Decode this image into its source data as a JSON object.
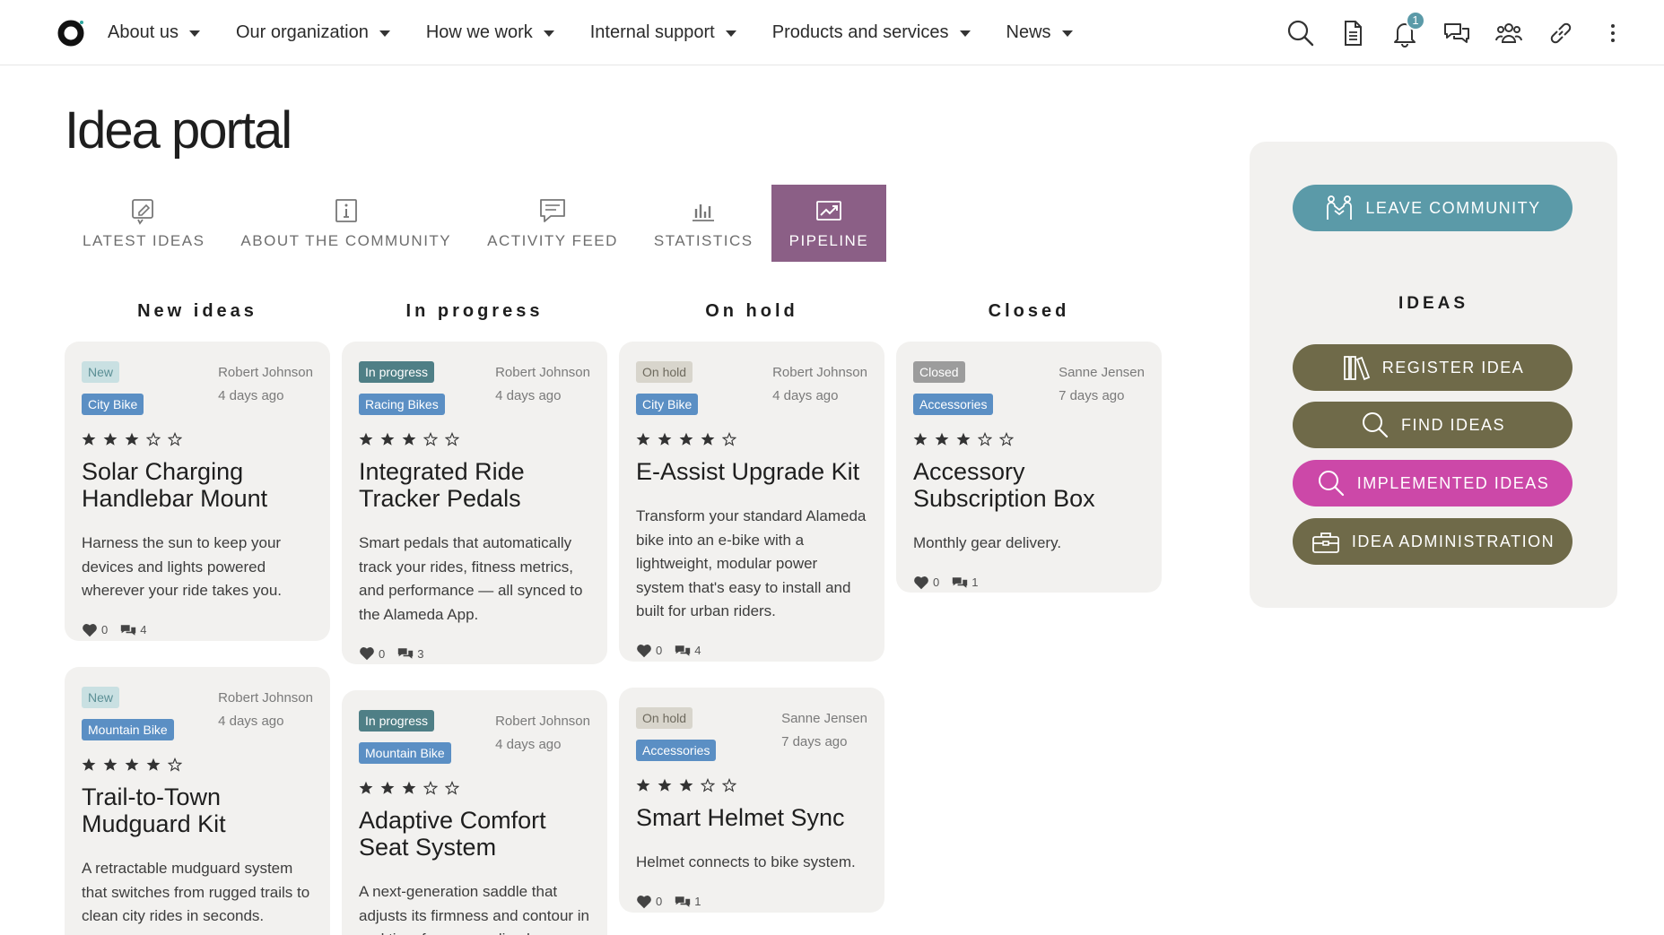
{
  "nav": {
    "items": [
      {
        "label": "About us"
      },
      {
        "label": "Our organization"
      },
      {
        "label": "How we work"
      },
      {
        "label": "Internal support"
      },
      {
        "label": "Products and services"
      },
      {
        "label": "News"
      }
    ],
    "notification_count": "1",
    "icons": [
      "search-icon",
      "document-icon",
      "bell-icon",
      "chat-icon",
      "people-icon",
      "link-icon",
      "more-icon"
    ]
  },
  "page": {
    "title": "Idea portal"
  },
  "tabs": [
    {
      "label": "LATEST IDEAS",
      "icon": "pencil-note-icon"
    },
    {
      "label": "ABOUT THE COMMUNITY",
      "icon": "info-icon"
    },
    {
      "label": "ACTIVITY FEED",
      "icon": "feed-icon"
    },
    {
      "label": "STATISTICS",
      "icon": "bar-chart-icon"
    },
    {
      "label": "PIPELINE",
      "icon": "trend-icon",
      "active": true
    }
  ],
  "columns": [
    {
      "title": "New ideas",
      "cards": [
        {
          "status": "New",
          "category": "City Bike",
          "author": "Robert Johnson",
          "time": "4 days ago",
          "rating": 3,
          "title": "Solar Charging Handlebar Mount",
          "description": "Harness the sun to keep your devices and lights powered wherever your ride takes you.",
          "likes": "0",
          "comments": "4"
        },
        {
          "status": "New",
          "category": "Mountain Bike",
          "author": "Robert Johnson",
          "time": "4 days ago",
          "rating": 4,
          "title": "Trail-to-Town Mudguard Kit",
          "description": "A retractable mudguard system that switches from rugged trails to clean city rides in seconds.",
          "likes": "",
          "comments": ""
        }
      ]
    },
    {
      "title": "In progress",
      "cards": [
        {
          "status": "In progress",
          "category": "Racing Bikes",
          "author": "Robert Johnson",
          "time": "4 days ago",
          "rating": 3,
          "title": "Integrated Ride Tracker Pedals",
          "description": "Smart pedals that automatically track your rides, fitness metrics, and performance — all synced to the Alameda App.",
          "likes": "0",
          "comments": "3"
        },
        {
          "status": "In progress",
          "category": "Mountain Bike",
          "author": "Robert Johnson",
          "time": "4 days ago",
          "rating": 3,
          "title": "Adaptive Comfort Seat System",
          "description": "A next-generation saddle that adjusts its firmness and contour in real time for personalized",
          "likes": "",
          "comments": ""
        }
      ]
    },
    {
      "title": "On hold",
      "cards": [
        {
          "status": "On hold",
          "category": "City Bike",
          "author": "Robert Johnson",
          "time": "4 days ago",
          "rating": 4,
          "title": "E-Assist Upgrade Kit",
          "description": "Transform your standard Alameda bike into an e-bike with a lightweight, modular power system that's easy to install and built for urban riders.",
          "likes": "0",
          "comments": "4"
        },
        {
          "status": "On hold",
          "category": "Accessories",
          "author": "Sanne Jensen",
          "time": "7 days ago",
          "rating": 3,
          "title": "Smart Helmet Sync",
          "description": "Helmet connects to bike system.",
          "likes": "0",
          "comments": "1"
        }
      ]
    },
    {
      "title": "Closed",
      "cards": [
        {
          "status": "Closed",
          "category": "Accessories",
          "author": "Sanne Jensen",
          "time": "7 days ago",
          "rating": 3,
          "title": "Accessory Subscription Box",
          "description": "Monthly gear delivery.",
          "likes": "0",
          "comments": "1"
        }
      ]
    }
  ],
  "sidebar": {
    "leave_label": "LEAVE COMMUNITY",
    "heading": "IDEAS",
    "buttons": [
      {
        "label": "REGISTER IDEA",
        "color": "#6f6a49",
        "icon": "books-icon"
      },
      {
        "label": "FIND IDEAS",
        "color": "#6f6a49",
        "icon": "search-icon"
      },
      {
        "label": "IMPLEMENTED IDEAS",
        "color": "#cc48a8",
        "icon": "search-icon"
      },
      {
        "label": "IDEA ADMINISTRATION",
        "color": "#6f6a49",
        "icon": "toolbox-icon"
      }
    ],
    "leave_color": "#5b9aa8"
  },
  "colors": {
    "tag_new": "#c9e0e2",
    "tag_new_text": "#5b8f95",
    "tag_in_progress": "#4f7f86",
    "tag_on_hold": "#d8d5cc",
    "tag_on_hold_text": "#6e6a5e",
    "tag_closed": "#9c9c9c",
    "tag_category": "#5b8fc4",
    "tab_active": "#8b5f86"
  }
}
